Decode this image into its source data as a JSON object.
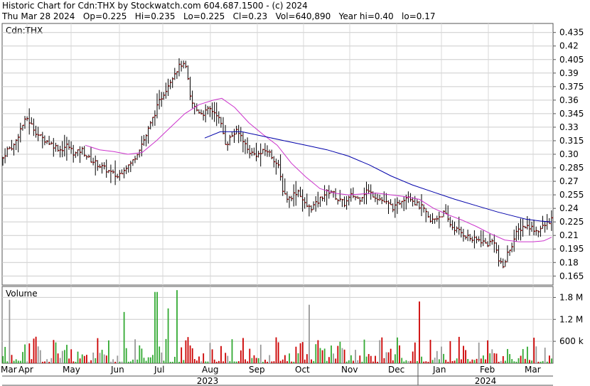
{
  "header": {
    "line1": "Historic Chart for Cdn:THX by Stockwatch.com 604.687.1500 - (c) 2024",
    "line2": "Thu Mar 28 2024   Op=0.225   Hi=0.235   Lo=0.225   Cl=0.23   Vol=640,890   Year hi=0.40   lo=0.17"
  },
  "chart_data": [
    {
      "type": "bar",
      "title": "Cdn:THX",
      "yticks": [
        "0.435",
        "0.42",
        "0.405",
        "0.39",
        "0.375",
        "0.36",
        "0.345",
        "0.33",
        "0.315",
        "0.30",
        "0.285",
        "0.27",
        "0.255",
        "0.24",
        "0.225",
        "0.21",
        "0.195",
        "0.18",
        "0.165"
      ],
      "ylim": [
        0.155,
        0.445
      ],
      "x_months": [
        "Mar",
        "Apr",
        "May",
        "Jun",
        "Jul",
        "Aug",
        "Sep",
        "Oct",
        "Nov",
        "Dec",
        "Jan",
        "Feb",
        "Mar"
      ],
      "x_years": [
        "2023",
        "2024"
      ],
      "grid": true,
      "series": [
        {
          "name": "",
          "kind": "ohlc",
          "color": "#8b0000",
          "close_points": [
            [
              0,
              0.29
            ],
            [
              10,
              0.305
            ],
            [
              20,
              0.31
            ],
            [
              30,
              0.33
            ],
            [
              38,
              0.34
            ],
            [
              46,
              0.33
            ],
            [
              55,
              0.32
            ],
            [
              65,
              0.315
            ],
            [
              75,
              0.31
            ],
            [
              85,
              0.305
            ],
            [
              95,
              0.31
            ],
            [
              105,
              0.3
            ],
            [
              115,
              0.305
            ],
            [
              125,
              0.295
            ],
            [
              135,
              0.29
            ],
            [
              145,
              0.285
            ],
            [
              155,
              0.28
            ],
            [
              165,
              0.275
            ],
            [
              175,
              0.285
            ],
            [
              185,
              0.29
            ],
            [
              195,
              0.305
            ],
            [
              205,
              0.32
            ],
            [
              215,
              0.34
            ],
            [
              225,
              0.36
            ],
            [
              235,
              0.375
            ],
            [
              245,
              0.39
            ],
            [
              255,
              0.4
            ],
            [
              262,
              0.395
            ],
            [
              268,
              0.36
            ],
            [
              275,
              0.35
            ],
            [
              285,
              0.345
            ],
            [
              295,
              0.35
            ],
            [
              305,
              0.345
            ],
            [
              312,
              0.33
            ],
            [
              318,
              0.31
            ],
            [
              325,
              0.32
            ],
            [
              332,
              0.325
            ],
            [
              340,
              0.32
            ],
            [
              348,
              0.305
            ],
            [
              356,
              0.3
            ],
            [
              365,
              0.3
            ],
            [
              375,
              0.305
            ],
            [
              385,
              0.295
            ],
            [
              392,
              0.285
            ],
            [
              398,
              0.26
            ],
            [
              405,
              0.25
            ],
            [
              412,
              0.255
            ],
            [
              420,
              0.26
            ],
            [
              428,
              0.245
            ],
            [
              436,
              0.24
            ],
            [
              445,
              0.245
            ],
            [
              455,
              0.255
            ],
            [
              465,
              0.26
            ],
            [
              475,
              0.25
            ],
            [
              485,
              0.245
            ],
            [
              495,
              0.255
            ],
            [
              505,
              0.25
            ],
            [
              515,
              0.26
            ],
            [
              525,
              0.255
            ],
            [
              535,
              0.25
            ],
            [
              545,
              0.245
            ],
            [
              555,
              0.24
            ],
            [
              565,
              0.25
            ],
            [
              575,
              0.255
            ],
            [
              585,
              0.245
            ],
            [
              595,
              0.24
            ],
            [
              605,
              0.225
            ],
            [
              615,
              0.23
            ],
            [
              625,
              0.235
            ],
            [
              635,
              0.22
            ],
            [
              645,
              0.215
            ],
            [
              655,
              0.21
            ],
            [
              665,
              0.205
            ],
            [
              675,
              0.205
            ],
            [
              685,
              0.2
            ],
            [
              695,
              0.205
            ],
            [
              702,
              0.18
            ],
            [
              708,
              0.175
            ],
            [
              714,
              0.19
            ],
            [
              720,
              0.2
            ],
            [
              728,
              0.215
            ],
            [
              736,
              0.22
            ],
            [
              745,
              0.22
            ],
            [
              755,
              0.215
            ],
            [
              765,
              0.22
            ],
            [
              772,
              0.225
            ],
            [
              778,
              0.23
            ]
          ]
        },
        {
          "name": "",
          "kind": "sma-short",
          "color": "#cc33cc",
          "points": [
            [
              120,
              0.31
            ],
            [
              140,
              0.305
            ],
            [
              160,
              0.303
            ],
            [
              180,
              0.3
            ],
            [
              200,
              0.302
            ],
            [
              220,
              0.315
            ],
            [
              240,
              0.33
            ],
            [
              260,
              0.345
            ],
            [
              280,
              0.355
            ],
            [
              300,
              0.36
            ],
            [
              312,
              0.362
            ],
            [
              330,
              0.352
            ],
            [
              350,
              0.335
            ],
            [
              370,
              0.322
            ],
            [
              390,
              0.31
            ],
            [
              410,
              0.29
            ],
            [
              430,
              0.275
            ],
            [
              450,
              0.262
            ],
            [
              470,
              0.257
            ],
            [
              490,
              0.255
            ],
            [
              510,
              0.256
            ],
            [
              530,
              0.257
            ],
            [
              550,
              0.255
            ],
            [
              570,
              0.253
            ],
            [
              590,
              0.25
            ],
            [
              610,
              0.24
            ],
            [
              630,
              0.233
            ],
            [
              650,
              0.227
            ],
            [
              670,
              0.22
            ],
            [
              690,
              0.212
            ],
            [
              710,
              0.205
            ],
            [
              730,
              0.203
            ],
            [
              750,
              0.203
            ],
            [
              765,
              0.204
            ],
            [
              776,
              0.208
            ]
          ]
        },
        {
          "name": "",
          "kind": "sma-long",
          "color": "#0000aa",
          "points": [
            [
              288,
              0.318
            ],
            [
              310,
              0.325
            ],
            [
              340,
              0.325
            ],
            [
              370,
              0.32
            ],
            [
              400,
              0.315
            ],
            [
              430,
              0.31
            ],
            [
              460,
              0.305
            ],
            [
              490,
              0.298
            ],
            [
              520,
              0.288
            ],
            [
              550,
              0.276
            ],
            [
              580,
              0.266
            ],
            [
              610,
              0.258
            ],
            [
              640,
              0.25
            ],
            [
              670,
              0.243
            ],
            [
              700,
              0.236
            ],
            [
              720,
              0.232
            ],
            [
              740,
              0.228
            ],
            [
              760,
              0.226
            ],
            [
              776,
              0.225
            ]
          ]
        }
      ]
    },
    {
      "type": "bar",
      "title": "Volume",
      "yticks": [
        "1.8 M",
        "1.2 M",
        "600 k"
      ],
      "ylim": [
        0,
        2100000
      ],
      "grid": true,
      "series": [
        {
          "name": "",
          "kind": "volume",
          "colors": {
            "up": "#33aa33",
            "down": "#cc0000",
            "flat": "#999999"
          }
        }
      ]
    }
  ]
}
